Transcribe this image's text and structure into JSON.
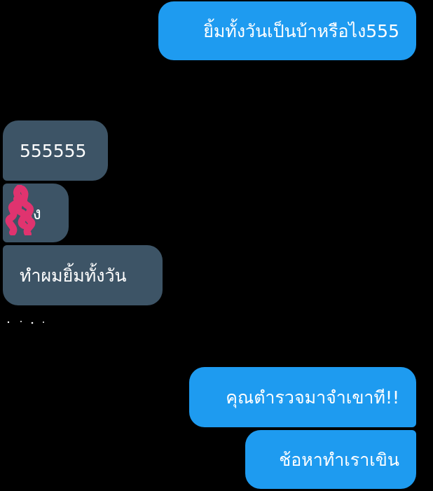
{
  "messages": [
    {
      "side": "sent",
      "text": "ยิ้มทั้งวันเป็นบ้าหรือไง555"
    },
    {
      "side": "received",
      "text": "555555"
    },
    {
      "side": "received",
      "text": "ไง"
    },
    {
      "side": "received",
      "text": "ทำผมยิ้มทั้งวัน"
    },
    {
      "side": "sent",
      "text": "คุณตำรวจมาจำเขาที!!"
    },
    {
      "side": "sent",
      "text": "ช้อหาทำเราเขิน"
    }
  ],
  "colors": {
    "background": "#000000",
    "sent_bubble": "#1e9bf0",
    "received_bubble": "#3d5466",
    "scribble": "#e0336f"
  },
  "icons": {
    "redaction": "pink-scribble-redaction"
  }
}
